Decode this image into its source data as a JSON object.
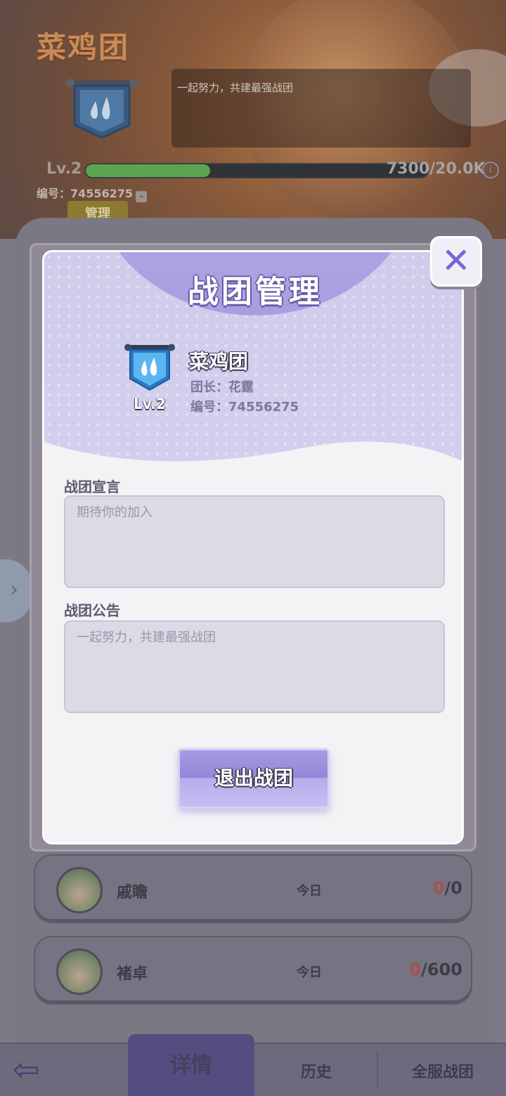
{
  "header": {
    "guild_title": "菜鸡团",
    "notice_text": "一起努力，共建最强战团",
    "level_label": "Lv.2",
    "xp_progress": 0.365,
    "xp_text": "7300/20.0K",
    "info_icon": "info-icon",
    "id_text": "编号：74556275",
    "copy_icon": "copy-icon",
    "manage_label": "管理"
  },
  "members": [
    {
      "name": "戚瞻",
      "today_label": "今日",
      "score_current": "0",
      "score_total": "/0"
    },
    {
      "name": "褚卓",
      "today_label": "今日",
      "score_current": "0",
      "score_total": "/600"
    }
  ],
  "modal": {
    "title": "战团管理",
    "close_icon": "close-icon",
    "guild_name": "菜鸡团",
    "level": "Lv.2",
    "leader": "团长：花霆",
    "guild_id": "编号：74556275",
    "declaration_label": "战团宣言",
    "declaration_placeholder": "期待你的加入",
    "announcement_label": "战团公告",
    "announcement_placeholder": "一起努力，共建最强战团",
    "quit_label": "退出战团"
  },
  "bottom_nav": {
    "back_icon": "arrow-left-icon",
    "tabs": [
      {
        "label": "详情",
        "active": true
      },
      {
        "label": "历史",
        "active": false
      },
      {
        "label": "全服战团",
        "active": false
      }
    ]
  },
  "colors": {
    "accent_purple": "#7a63d6",
    "xp_green": "#5aa452",
    "score_red": "#a5514d"
  }
}
